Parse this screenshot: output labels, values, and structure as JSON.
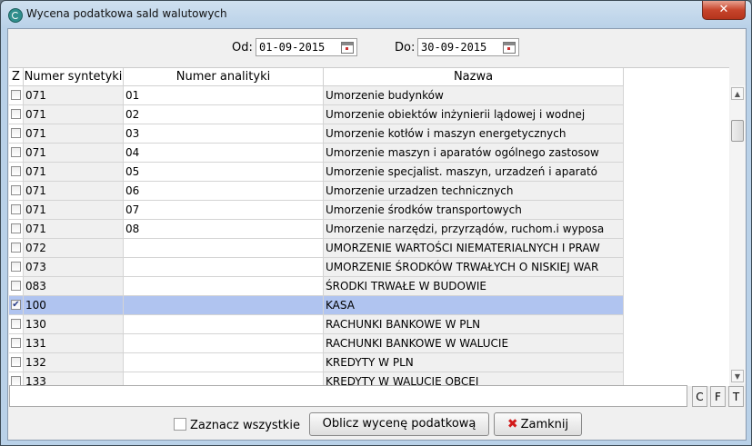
{
  "window": {
    "title": "Wycena podatkowa sald walutowych",
    "close_glyph": "✕"
  },
  "dates": {
    "from_label": "Od:",
    "from_value": "01-09-2015",
    "to_label": "Do:",
    "to_value": "30-09-2015"
  },
  "grid": {
    "columns": {
      "check": "Z",
      "synthetic": "Numer syntetyki",
      "analytic": "Numer analityki",
      "name": "Nazwa"
    },
    "rows": [
      {
        "checked": false,
        "synthetic": "071",
        "analytic": "01",
        "name": "Umorzenie budynków"
      },
      {
        "checked": false,
        "synthetic": "071",
        "analytic": "02",
        "name": "Umorzenie obiektów inżynierii lądowej i wodnej"
      },
      {
        "checked": false,
        "synthetic": "071",
        "analytic": "03",
        "name": "Umorzenie kotłów i maszyn energetycznych"
      },
      {
        "checked": false,
        "synthetic": "071",
        "analytic": "04",
        "name": "Umorzenie maszyn i aparatów ogólnego zastosow"
      },
      {
        "checked": false,
        "synthetic": "071",
        "analytic": "05",
        "name": "Umorzenie specjalist. maszyn, urzadzeń i aparató"
      },
      {
        "checked": false,
        "synthetic": "071",
        "analytic": "06",
        "name": "Umorzenie urzadzen technicznych"
      },
      {
        "checked": false,
        "synthetic": "071",
        "analytic": "07",
        "name": "Umorzenie środków transportowych"
      },
      {
        "checked": false,
        "synthetic": "071",
        "analytic": "08",
        "name": "Umorzenie narzędzi, przyrządów, ruchom.i wyposa"
      },
      {
        "checked": false,
        "synthetic": "072",
        "analytic": "",
        "name": "UMORZENIE WARTOŚCI NIEMATERIALNYCH I PRAW"
      },
      {
        "checked": false,
        "synthetic": "073",
        "analytic": "",
        "name": "UMORZENIE ŚRODKÓW TRWAŁYCH O NISKIEJ WAR"
      },
      {
        "checked": false,
        "synthetic": "083",
        "analytic": "",
        "name": "ŚRODKI TRWAŁE W BUDOWIE"
      },
      {
        "checked": true,
        "synthetic": "100",
        "analytic": "",
        "name": "KASA"
      },
      {
        "checked": false,
        "synthetic": "130",
        "analytic": "",
        "name": "RACHUNKI BANKOWE W PLN"
      },
      {
        "checked": false,
        "synthetic": "131",
        "analytic": "",
        "name": "RACHUNKI BANKOWE W WALUCIE"
      },
      {
        "checked": false,
        "synthetic": "132",
        "analytic": "",
        "name": "KREDYTY W PLN"
      },
      {
        "checked": false,
        "synthetic": "133",
        "analytic": "",
        "name": "KREDYTY W WALUCIE OBCEJ"
      }
    ],
    "selected_row": 11
  },
  "filter_buttons": [
    "C",
    "F",
    "T"
  ],
  "footer": {
    "select_all_label": "Zaznacz wszystkie",
    "compute_label": "Oblicz wycenę podatkową",
    "close_label": "Zamknij"
  }
}
